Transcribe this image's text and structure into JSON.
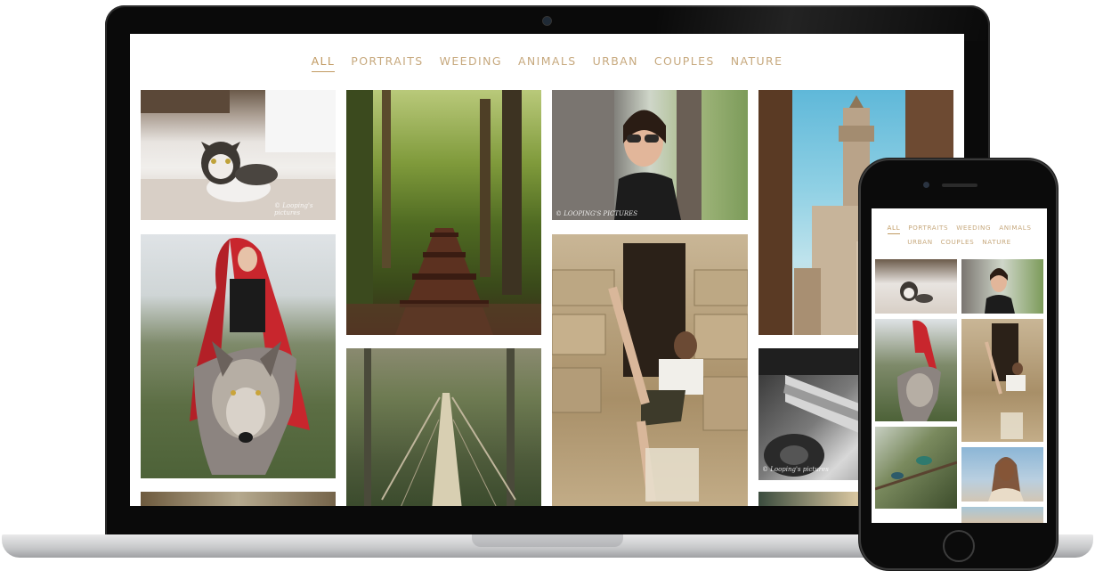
{
  "gallery": {
    "filters": [
      "ALL",
      "PORTRAITS",
      "WEEDING",
      "ANIMALS",
      "URBAN",
      "COUPLES",
      "NATURE"
    ],
    "active_filter": "ALL"
  },
  "watermarks": {
    "cat": "© Looping's pictures",
    "portrait": "© LOOPING'S PICTURES",
    "moto": "© Looping's pictures"
  },
  "mobile": {
    "filters_row1": [
      "ALL",
      "PORTRAITS",
      "WEEDING",
      "ANIMALS"
    ],
    "filters_row2": [
      "URBAN",
      "COUPLES",
      "NATURE"
    ]
  },
  "colors": {
    "accent": "#c19a62",
    "filter_text": "#c7a97e"
  }
}
